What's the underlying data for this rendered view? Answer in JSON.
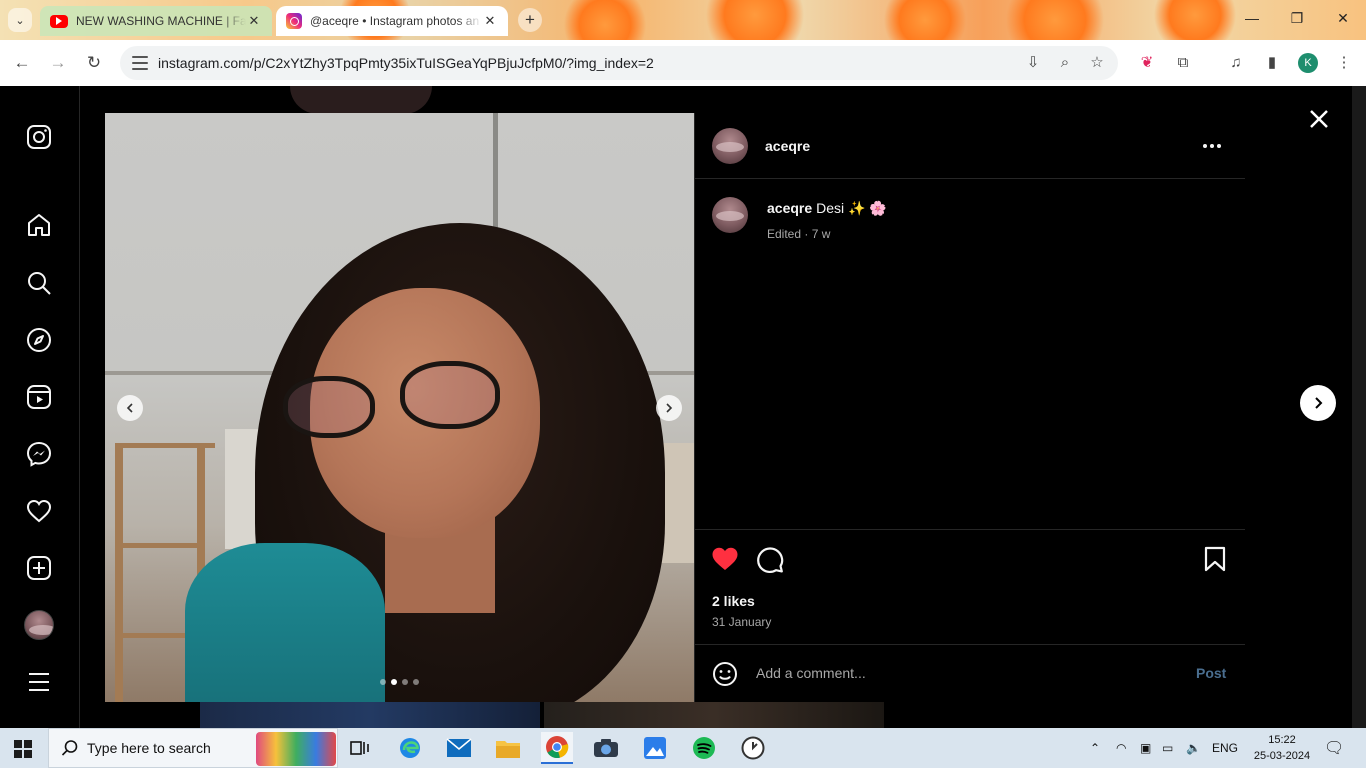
{
  "browser": {
    "tabs": [
      {
        "title": "NEW WASHING MACHINE | Fan",
        "favicon": "youtube-icon",
        "active": false
      },
      {
        "title": "@aceqre • Instagram photos an",
        "favicon": "instagram-icon",
        "active": true
      }
    ],
    "url": "instagram.com/p/C2xYtZhy3TpqPmty35ixTuISGeaYqPBjuJcfpM0/?img_index=2",
    "profile_initial": "K"
  },
  "post": {
    "username": "aceqre",
    "caption_user": "aceqre",
    "caption_text": "Desi ✨ 🌸",
    "meta": "Edited · 7 w",
    "likes": "2 likes",
    "date": "31 January",
    "comment_placeholder": "Add a comment...",
    "post_label": "Post",
    "carousel": {
      "count": 4,
      "active_index": 1
    },
    "liked": true
  },
  "sidebar": {
    "items": [
      "instagram-logo",
      "home",
      "search",
      "explore",
      "reels",
      "messages",
      "notifications",
      "create",
      "profile",
      "more"
    ]
  },
  "taskbar": {
    "search_placeholder": "Type here to search",
    "language": "ENG",
    "time": "15:22",
    "date": "25-03-2024"
  },
  "colors": {
    "like_red": "#ff3040",
    "post_blue": "#4a6e8f",
    "panel_bg": "#000000"
  }
}
